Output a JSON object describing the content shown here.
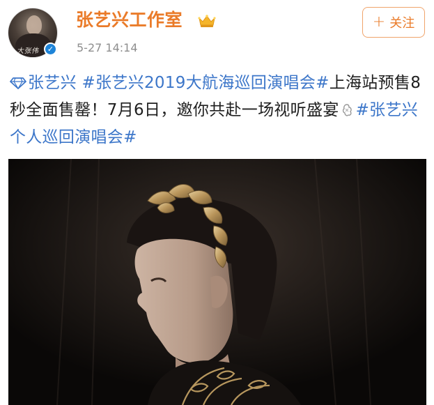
{
  "header": {
    "username": "张艺兴工作室",
    "timestamp": "5-27  14:14",
    "follow_label": "关注",
    "follow_plus": "+",
    "avatar_signature": "大张伟",
    "verified_mark": "✓"
  },
  "post": {
    "tag_person": "张艺兴",
    "hashtag_tour": "#张艺兴2019大航海巡回演唱会#",
    "text_line_a": "上海站预售8秒全面售罄！7月6日，邀你共赴一场视听盛宴",
    "hashtag_personal": "#张艺兴个人巡回演唱会#"
  },
  "colors": {
    "username": "#ea7b29",
    "link": "#3c76c9",
    "follow_border": "#f0a46b",
    "timestamp": "#8e8e8e",
    "verified": "#1e84d8"
  },
  "icons": {
    "crown": "crown-icon",
    "diamond": "diamond-icon",
    "sparkle": "sparkle-icon",
    "plus": "plus-icon",
    "verified": "verified-icon"
  }
}
